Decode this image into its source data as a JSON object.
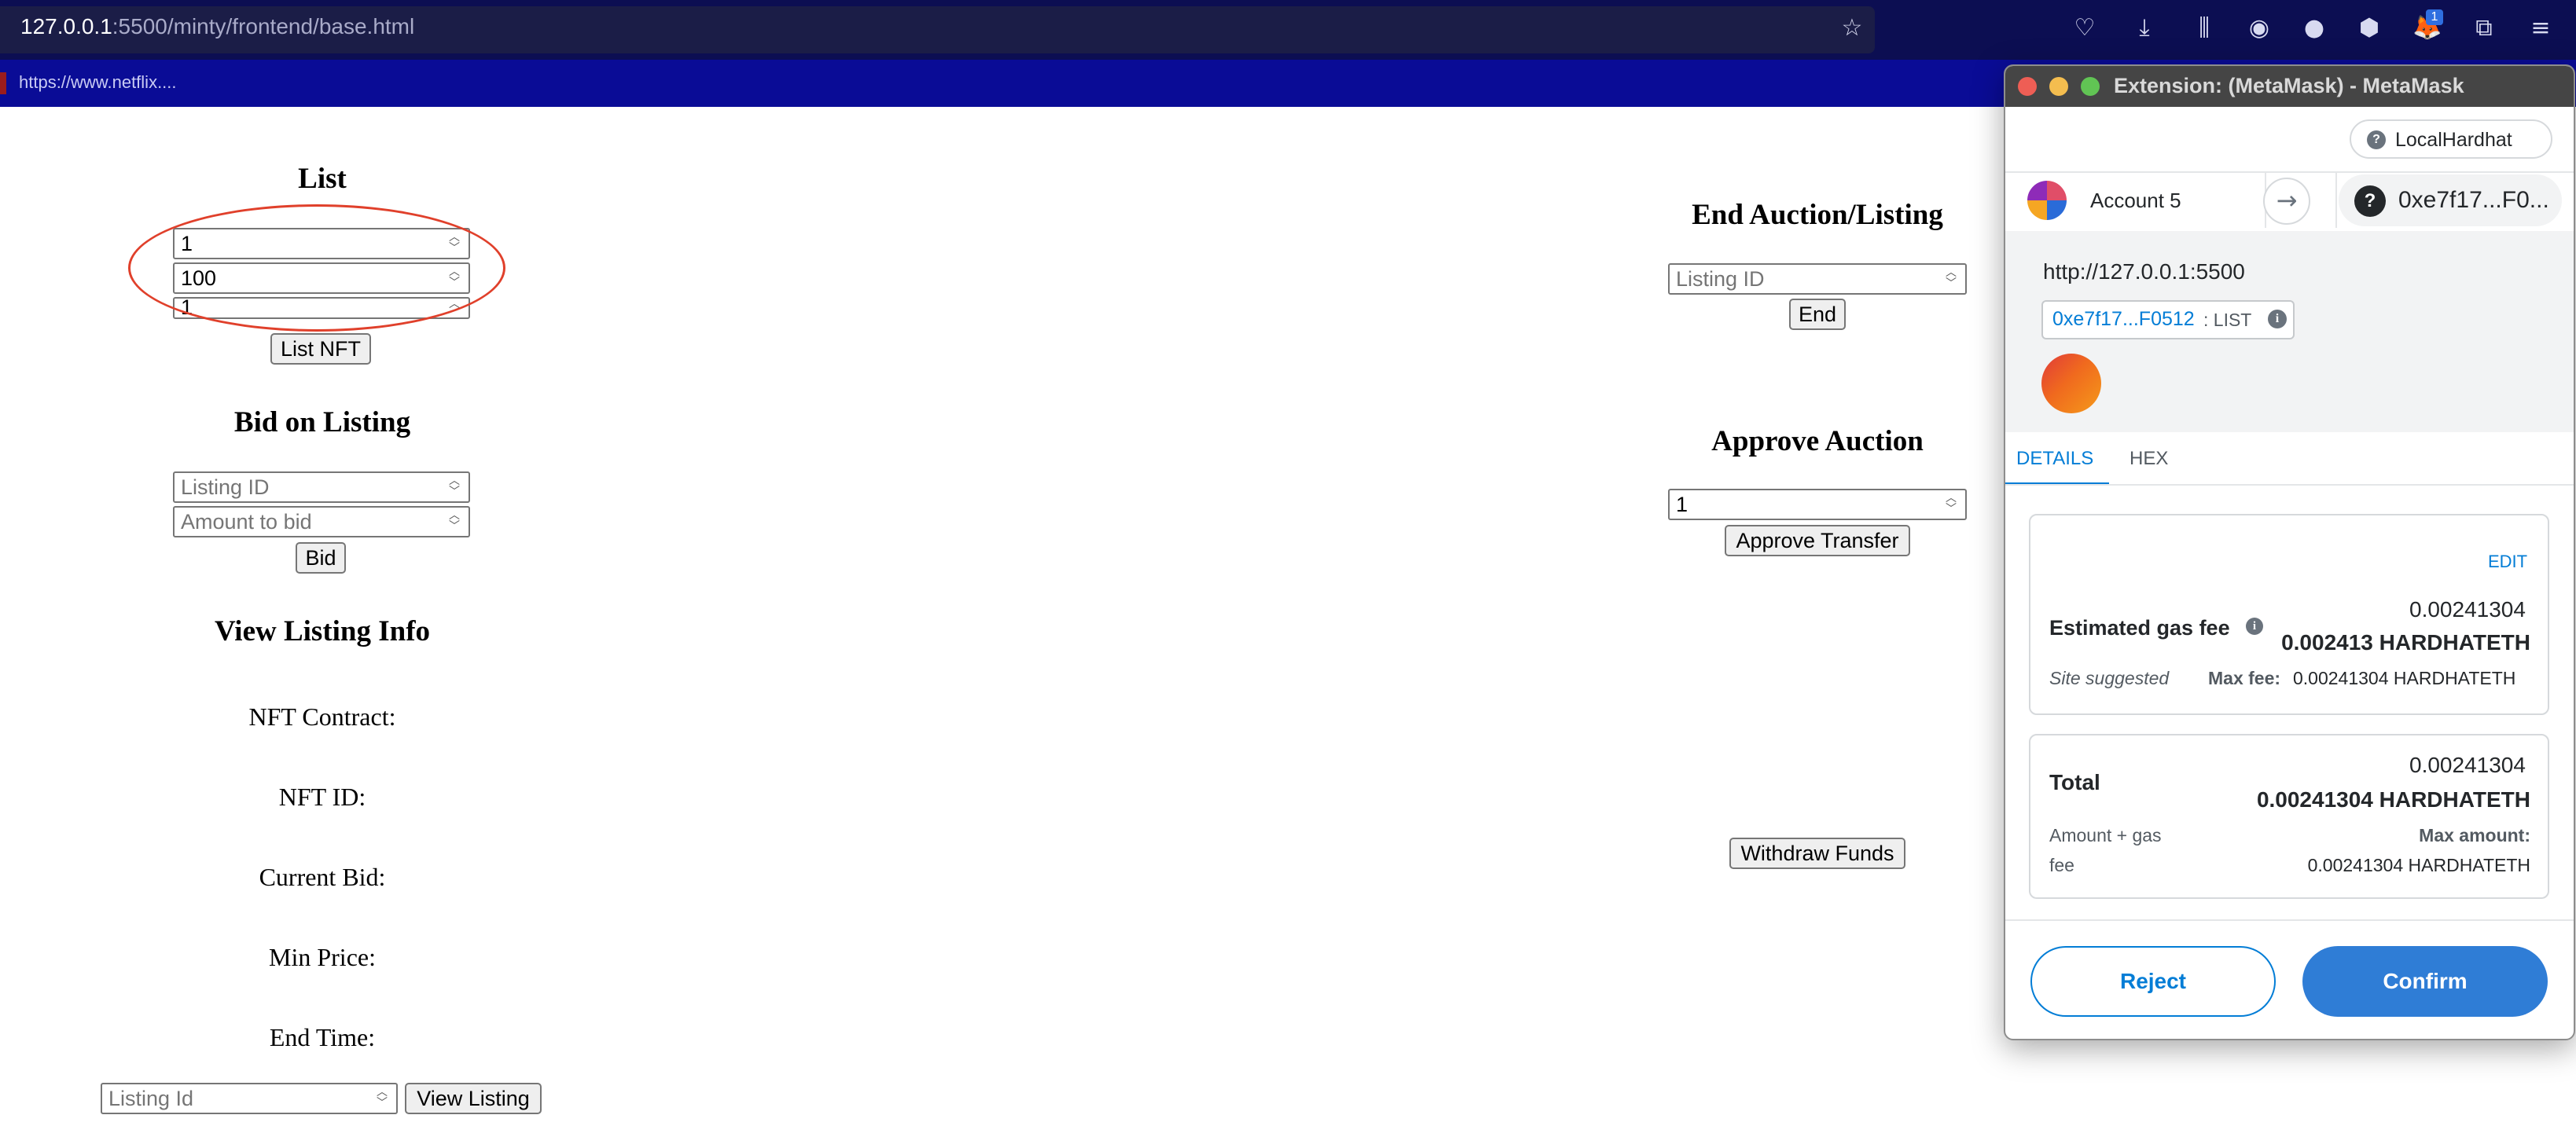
{
  "browser": {
    "url_host": "127.0.0.1",
    "url_path": ":5500/minty/frontend/base.html",
    "bookmark": "https://www.netflix....",
    "toolbar_badge": "1"
  },
  "list": {
    "title": "List",
    "input1_value": "1",
    "input2_value": "100",
    "input3_value": "1",
    "button": "List NFT"
  },
  "bid": {
    "title": "Bid on Listing",
    "listing_placeholder": "Listing ID",
    "amount_placeholder": "Amount to bid",
    "button": "Bid"
  },
  "view": {
    "title": "View Listing Info",
    "nft_contract": "NFT Contract:",
    "nft_id": "NFT ID:",
    "current_bid": "Current Bid:",
    "min_price": "Min Price:",
    "end_time": "End Time:",
    "listing_placeholder": "Listing Id",
    "button": "View Listing"
  },
  "end": {
    "title": "End Auction/Listing",
    "listing_placeholder": "Listing ID",
    "button": "End"
  },
  "approve": {
    "title": "Approve Auction",
    "input_value": "1",
    "button": "Approve Transfer"
  },
  "withdraw": {
    "button": "Withdraw Funds"
  },
  "metamask": {
    "window_title": "Extension: (MetaMask) - MetaMask",
    "network": "LocalHardhat",
    "account": "Account 5",
    "to_address": "0xe7f17...F0...",
    "origin": "http://127.0.0.1:5500",
    "contract_address": "0xe7f17...F0512",
    "method": ": LIST",
    "tabs": [
      "DETAILS",
      "HEX"
    ],
    "edit": "EDIT",
    "gas_amount": "0.00241304",
    "gas_label": "Estimated gas fee",
    "gas_bold": "0.002413 HARDHATETH",
    "site_suggested": "Site suggested",
    "max_fee_label": "Max fee:",
    "max_fee_value": "0.00241304 HARDHATETH",
    "total_amount": "0.00241304",
    "total_label": "Total",
    "total_bold": "0.00241304 HARDHATETH",
    "amount_gas_1": "Amount + gas",
    "amount_gas_2": "fee",
    "max_amount_label": "Max amount:",
    "max_amount_value": "0.00241304 HARDHATETH",
    "reject": "Reject",
    "confirm": "Confirm"
  },
  "colors": {
    "urlbar": "#0c0e52",
    "bookbar": "#0a0c96",
    "annotation": "#e0402b",
    "mm_blue": "#037dd6",
    "mm_confirm": "#2f7dd6"
  }
}
